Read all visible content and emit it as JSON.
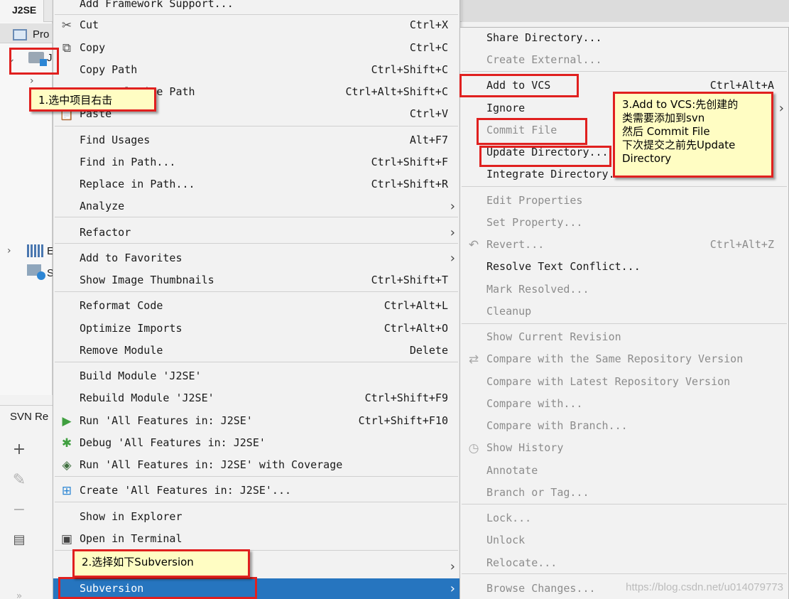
{
  "ide": {
    "project_name": "J2SE",
    "project_tool_label": "Pro",
    "tree_root_label": "J",
    "tree_libs_label": "E",
    "tree_scratch_label": "S",
    "svn_panel_label": "SVN Re"
  },
  "context_menu": {
    "items": [
      {
        "label": "Add Framework Support...",
        "shortcut": ""
      },
      {
        "label": "Cut",
        "shortcut": "Ctrl+X",
        "icon": "scissors-icon"
      },
      {
        "label": "Copy",
        "shortcut": "Ctrl+C",
        "icon": "copy-icon"
      },
      {
        "label": "Copy Path",
        "shortcut": "Ctrl+Shift+C"
      },
      {
        "label": "Copy Relative Path",
        "shortcut": "Ctrl+Alt+Shift+C"
      },
      {
        "label": "Paste",
        "shortcut": "Ctrl+V",
        "icon": "paste-icon"
      },
      {
        "label": "Find Usages",
        "shortcut": "Alt+F7"
      },
      {
        "label": "Find in Path...",
        "shortcut": "Ctrl+Shift+F"
      },
      {
        "label": "Replace in Path...",
        "shortcut": "Ctrl+Shift+R"
      },
      {
        "label": "Analyze",
        "shortcut": "",
        "submenu": true
      },
      {
        "label": "Refactor",
        "shortcut": "",
        "submenu": true
      },
      {
        "label": "Add to Favorites",
        "shortcut": "",
        "submenu": true
      },
      {
        "label": "Show Image Thumbnails",
        "shortcut": "Ctrl+Shift+T"
      },
      {
        "label": "Reformat Code",
        "shortcut": "Ctrl+Alt+L"
      },
      {
        "label": "Optimize Imports",
        "shortcut": "Ctrl+Alt+O"
      },
      {
        "label": "Remove Module",
        "shortcut": "Delete"
      },
      {
        "label": "Build Module 'J2SE'",
        "shortcut": ""
      },
      {
        "label": "Rebuild Module 'J2SE'",
        "shortcut": "Ctrl+Shift+F9"
      },
      {
        "label": "Run 'All Features in: J2SE'",
        "shortcut": "Ctrl+Shift+F10",
        "icon": "run-icon"
      },
      {
        "label": "Debug 'All Features in: J2SE'",
        "shortcut": "",
        "icon": "debug-icon"
      },
      {
        "label": "Run 'All Features in: J2SE' with Coverage",
        "shortcut": "",
        "icon": "coverage-icon"
      },
      {
        "label": "Create 'All Features in: J2SE'...",
        "shortcut": "",
        "icon": "create-config-icon"
      },
      {
        "label": "Show in Explorer",
        "shortcut": ""
      },
      {
        "label": "Open in Terminal",
        "shortcut": "",
        "icon": "terminal-icon"
      },
      {
        "label": "",
        "shortcut": "",
        "submenu": true
      },
      {
        "label": "Subversion",
        "shortcut": "",
        "submenu": true,
        "selected": true
      }
    ]
  },
  "subversion_menu": {
    "items": [
      {
        "label": "Share Directory...",
        "shortcut": ""
      },
      {
        "label": "Create External...",
        "shortcut": "",
        "disabled": true
      },
      {
        "label": "Add to VCS",
        "shortcut": "Ctrl+Alt+A"
      },
      {
        "label": "Ignore",
        "shortcut": "",
        "submenu": true
      },
      {
        "label": "Commit File",
        "shortcut": "",
        "disabled": true
      },
      {
        "label": "Update Directory...",
        "shortcut": ""
      },
      {
        "label": "Integrate Directory...",
        "shortcut": ""
      },
      {
        "label": "Edit Properties",
        "shortcut": "",
        "disabled": true
      },
      {
        "label": "Set Property...",
        "shortcut": "",
        "disabled": true
      },
      {
        "label": "Revert...",
        "shortcut": "Ctrl+Alt+Z",
        "disabled": true,
        "icon": "revert-icon"
      },
      {
        "label": "Resolve Text Conflict...",
        "shortcut": ""
      },
      {
        "label": "Mark Resolved...",
        "shortcut": "",
        "disabled": true
      },
      {
        "label": "Cleanup",
        "shortcut": "",
        "disabled": true
      },
      {
        "label": "Show Current Revision",
        "shortcut": "",
        "disabled": true
      },
      {
        "label": "Compare with the Same Repository Version",
        "shortcut": "",
        "disabled": true,
        "icon": "compare-icon"
      },
      {
        "label": "Compare with Latest Repository Version",
        "shortcut": "",
        "disabled": true
      },
      {
        "label": "Compare with...",
        "shortcut": "",
        "disabled": true
      },
      {
        "label": "Compare with Branch...",
        "shortcut": "",
        "disabled": true
      },
      {
        "label": "Show History",
        "shortcut": "",
        "disabled": true,
        "icon": "history-icon"
      },
      {
        "label": "Annotate",
        "shortcut": "",
        "disabled": true
      },
      {
        "label": "Branch or Tag...",
        "shortcut": "",
        "disabled": true
      },
      {
        "label": "Lock...",
        "shortcut": "",
        "disabled": true
      },
      {
        "label": "Unlock",
        "shortcut": "",
        "disabled": true
      },
      {
        "label": "Relocate...",
        "shortcut": "",
        "disabled": true
      },
      {
        "label": "Browse Changes...",
        "shortcut": "",
        "disabled": true
      }
    ]
  },
  "annotations": {
    "step1": "1.选中项目右击",
    "step2": "2.选择如下Subversion",
    "step3_lines": [
      "3.Add to VCS:先创建的",
      "类需要添加到svn",
      "然后 Commit File",
      "下次提交之前先Update",
      "Directory"
    ]
  },
  "watermark": "https://blog.csdn.net/u014079773",
  "colors": {
    "selection": "#2675bf",
    "annotation_red": "#e0201f",
    "note_yellow": "#fffdc3",
    "disabled_text": "#8c8c8c"
  }
}
